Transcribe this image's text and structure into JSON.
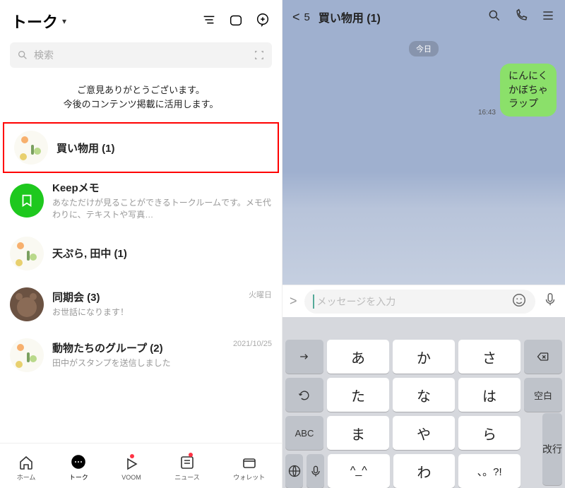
{
  "left": {
    "title": "トーク",
    "search_placeholder": "検索",
    "thanks_line1": "ご意見ありがとうございます。",
    "thanks_line2": "今後のコンテンツ掲載に活用します。",
    "rows": [
      {
        "title": "買い物用  (1)",
        "sub": "",
        "meta": ""
      },
      {
        "title": "Keepメモ",
        "sub": "あなただけが見ることができるトークルームです。メモ代わりに、テキストや写真…",
        "meta": ""
      },
      {
        "title": "天ぷら, 田中  (1)",
        "sub": "",
        "meta": ""
      },
      {
        "title": "同期会  (3)",
        "sub": "お世話になります！",
        "meta": "火曜日"
      },
      {
        "title": "動物たちのグループ  (2)",
        "sub": "田中がスタンプを送信しました",
        "meta": "2021/10/25"
      }
    ],
    "nav": {
      "home": "ホーム",
      "talk": "トーク",
      "voom": "VOOM",
      "news": "ニュース",
      "wallet": "ウォレット"
    }
  },
  "right": {
    "back_count": "5",
    "title": "買い物用 (1)",
    "date_label": "今日",
    "message": "にんにく\nかぼちゃ\nラップ",
    "msg_time": "16:43",
    "input_placeholder": "メッセージを入力"
  },
  "keyboard": {
    "rows": [
      [
        "→",
        "あ",
        "か",
        "さ",
        "⌫"
      ],
      [
        "↺",
        "た",
        "な",
        "は",
        "空白"
      ],
      [
        "ABC",
        "ま",
        "や",
        "ら",
        "改行"
      ],
      [
        "🌐",
        "🎤",
        "^_^",
        "わ",
        "、。?!",
        ""
      ]
    ],
    "space_label": "空白",
    "enter_label": "改行",
    "abc_label": "ABC"
  }
}
